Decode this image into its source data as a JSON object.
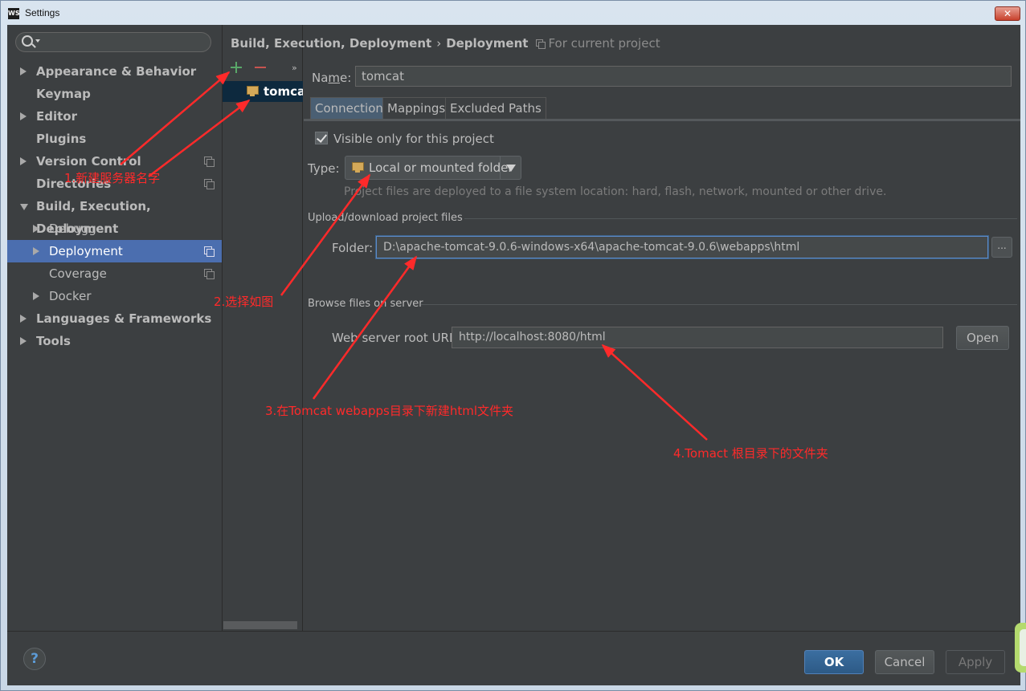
{
  "window": {
    "app_icon": "WS",
    "title": "Settings",
    "close_label": "✕"
  },
  "sidebar": {
    "items": [
      {
        "label": "Appearance & Behavior",
        "bold": true,
        "expander": "right",
        "indent": 0,
        "copy": false
      },
      {
        "label": "Keymap",
        "bold": true,
        "expander": "none",
        "indent": 0,
        "copy": false
      },
      {
        "label": "Editor",
        "bold": true,
        "expander": "right",
        "indent": 0,
        "copy": false
      },
      {
        "label": "Plugins",
        "bold": true,
        "expander": "none",
        "indent": 0,
        "copy": false
      },
      {
        "label": "Version Control",
        "bold": true,
        "expander": "right",
        "indent": 0,
        "copy": true
      },
      {
        "label": "Directories",
        "bold": true,
        "expander": "none",
        "indent": 0,
        "copy": true
      },
      {
        "label": "Build, Execution, Deployment",
        "bold": true,
        "expander": "down",
        "indent": 0,
        "copy": false
      },
      {
        "label": "Debugger",
        "bold": false,
        "expander": "right",
        "indent": 1,
        "copy": false
      },
      {
        "label": "Deployment",
        "bold": false,
        "expander": "right",
        "indent": 1,
        "copy": true,
        "selected": true
      },
      {
        "label": "Coverage",
        "bold": false,
        "expander": "none",
        "indent": 1,
        "copy": true
      },
      {
        "label": "Docker",
        "bold": false,
        "expander": "right",
        "indent": 1,
        "copy": false
      },
      {
        "label": "Languages & Frameworks",
        "bold": true,
        "expander": "right",
        "indent": 0,
        "copy": false
      },
      {
        "label": "Tools",
        "bold": true,
        "expander": "right",
        "indent": 0,
        "copy": false
      }
    ]
  },
  "server_list": {
    "more_label": "»",
    "items": [
      {
        "label": "tomcat"
      }
    ]
  },
  "breadcrumb": {
    "part1": "Build, Execution, Deployment",
    "separator": "›",
    "part2": "Deployment",
    "scope": "For current project"
  },
  "form": {
    "name_label": "Name:",
    "name_value": "tomcat",
    "tabs": [
      "Connection",
      "Mappings",
      "Excluded Paths"
    ],
    "active_tab": 0,
    "visible_only_label": "Visible only for this project",
    "visible_only_checked": true,
    "type_label": "Type:",
    "type_value": "Local or mounted folder",
    "type_description": "Project files are deployed to a file system location: hard, flash, network, mounted or other drive.",
    "upload_section": "Upload/download project files",
    "folder_label": "Folder:",
    "folder_value": "D:\\apache-tomcat-9.0.6-windows-x64\\apache-tomcat-9.0.6\\webapps\\html",
    "browse_label": "...",
    "browse_section": "Browse files on server",
    "url_label": "Web server root URL:",
    "url_value": "http://localhost:8080/html",
    "open_label": "Open"
  },
  "footer": {
    "help_label": "?",
    "ok_label": "OK",
    "cancel_label": "Cancel",
    "apply_label": "Apply"
  },
  "annotations": [
    {
      "text": "1.新建服务器名字"
    },
    {
      "text": "2.选择如图"
    },
    {
      "text": "3.在Tomcat  webapps目录下新建html文件夹"
    },
    {
      "text": "4.Tomact  根目录下的文件夹"
    }
  ],
  "colors": {
    "selection": "#4b6eaf",
    "annotation": "#ff2a2a",
    "add_icon": "#59a869",
    "remove_icon": "#c75450"
  }
}
